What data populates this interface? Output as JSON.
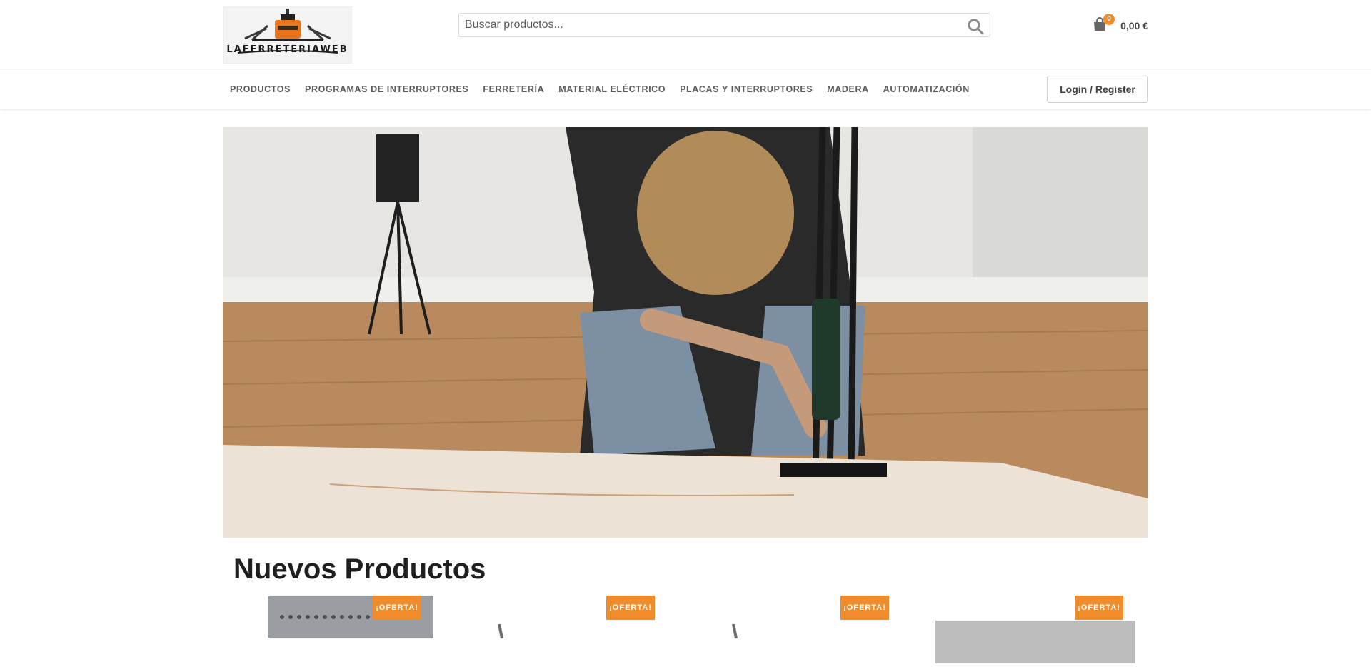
{
  "brand": {
    "logo_text": "LAFERRETERIAWEB"
  },
  "search": {
    "placeholder": "Buscar productos..."
  },
  "cart": {
    "count": "0",
    "total": "0,00 €"
  },
  "nav": {
    "items": [
      {
        "label": "PRODUCTOS"
      },
      {
        "label": "PROGRAMAS DE INTERRUPTORES"
      },
      {
        "label": "FERRETERÍA"
      },
      {
        "label": "MATERIAL ELÉCTRICO"
      },
      {
        "label": "PLACAS Y INTERRUPTORES"
      },
      {
        "label": "MADERA"
      },
      {
        "label": "AUTOMATIZACIÓN"
      }
    ],
    "login_label": "Login / Register"
  },
  "products_section": {
    "title": "Nuevos Productos",
    "products": [
      {
        "badge": "¡OFERTA!"
      },
      {
        "badge": "¡OFERTA!"
      },
      {
        "badge": "¡OFERTA!"
      },
      {
        "badge": "¡OFERTA!"
      }
    ]
  },
  "colors": {
    "accent": "#f08c2c",
    "text_dark": "#1f1f1f",
    "nav_text": "#5c5c5c"
  }
}
